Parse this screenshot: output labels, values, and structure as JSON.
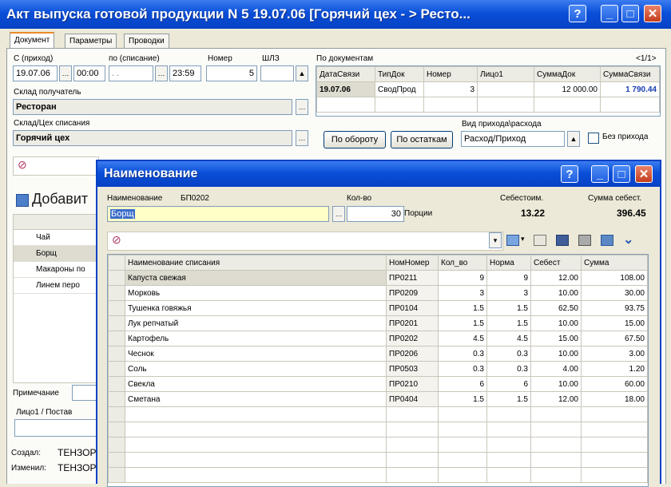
{
  "main": {
    "title": "Акт выпуска готовой продукции N 5 19.07.06 [Горячий цех - > Ресто...",
    "tabs": [
      "Документ",
      "Параметры",
      "Проводки"
    ],
    "from_label": "С (приход)",
    "from_date": "19.07.06",
    "from_time": "00:00",
    "to_label": "по (списание)",
    "to_date": ". .",
    "to_time": "23:59",
    "number_label": "Номер",
    "number_value": "5",
    "shlz_label": "ШЛЗ",
    "receiver_label": "Склад получатель",
    "receiver_value": "Ресторан",
    "source_label": "Склад/Цех списания",
    "source_value": "Горячий цех",
    "by_docs_label": "По документам",
    "page_indicator": "<1/1>",
    "docs_columns": [
      "ДатаСвязи",
      "ТипДок",
      "Номер",
      "Лицо1",
      "СуммаДок",
      "СуммаСвязи"
    ],
    "docs_row": [
      "19.07.06",
      "СводПрод",
      "3",
      "",
      "12 000.00",
      "1 790.44"
    ],
    "btn_turnover": "По обороту",
    "btn_remains": "По остаткам",
    "income_type_label": "Вид прихода\\расхода",
    "income_type_value": "Расход/Приход",
    "no_income_label": "Без прихода",
    "add_label": "Добавит",
    "left_items": [
      "Чай",
      "Борщ",
      "Макароны по",
      "Линем перо"
    ],
    "note_label": "Примечание",
    "person_label": "Лицо1 / Постав",
    "created_label": "Создал:",
    "created_value": "ТЕНЗОР",
    "changed_label": "Изменил:",
    "changed_value": "ТЕНЗОР"
  },
  "dialog": {
    "title": "Наименование",
    "name_label": "Наименование",
    "name_code": "БП0202",
    "name_value": "Борщ",
    "qty_label": "Кол-во",
    "qty_value": "30",
    "qty_unit": "Порции",
    "cost_label": "Себестоим.",
    "cost_value": "13.22",
    "sum_cost_label": "Сумма себест.",
    "sum_cost_value": "396.45",
    "columns": [
      "Наименование списания",
      "НомНомер",
      "Кол_во",
      "Норма",
      "Себест",
      "Сумма"
    ],
    "rows": [
      [
        "Капуста свежая",
        "ПР0211",
        "9",
        "9",
        "12.00",
        "108.00"
      ],
      [
        "Морковь",
        "ПР0209",
        "3",
        "3",
        "10.00",
        "30.00"
      ],
      [
        "Тушенка говяжья",
        "ПР0104",
        "1.5",
        "1.5",
        "62.50",
        "93.75"
      ],
      [
        "Лук репчатый",
        "ПР0201",
        "1.5",
        "1.5",
        "10.00",
        "15.00"
      ],
      [
        "Картофель",
        "ПР0202",
        "4.5",
        "4.5",
        "15.00",
        "67.50"
      ],
      [
        "Чеснок",
        "ПР0206",
        "0.3",
        "0.3",
        "10.00",
        "3.00"
      ],
      [
        "Соль",
        "ПР0503",
        "0.3",
        "0.3",
        "4.00",
        "1.20"
      ],
      [
        "Свекла",
        "ПР0210",
        "6",
        "6",
        "10.00",
        "60.00"
      ],
      [
        "Сметана",
        "ПР0404",
        "1.5",
        "1.5",
        "12.00",
        "18.00"
      ]
    ]
  }
}
